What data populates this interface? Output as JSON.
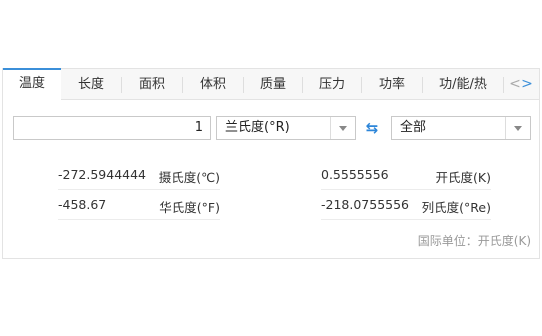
{
  "tabs": [
    {
      "label": "温度",
      "active": true
    },
    {
      "label": "长度",
      "active": false
    },
    {
      "label": "面积",
      "active": false
    },
    {
      "label": "体积",
      "active": false
    },
    {
      "label": "质量",
      "active": false
    },
    {
      "label": "压力",
      "active": false
    },
    {
      "label": "功率",
      "active": false
    },
    {
      "label": "功/能/热",
      "active": false
    }
  ],
  "nav": {
    "prev": "<",
    "next": ">"
  },
  "converter": {
    "input_value": "1",
    "from_unit": "兰氏度(°R)",
    "to_unit": "全部",
    "swap_icon": "swap-arrows-icon"
  },
  "results": [
    {
      "value": "-272.5944444",
      "unit": "摄氏度(℃)"
    },
    {
      "value": "0.5555556",
      "unit": "开氏度(K)"
    },
    {
      "value": "-458.67",
      "unit": "华氏度(°F)"
    },
    {
      "value": "-218.0755556",
      "unit": "列氏度(°Re)"
    }
  ],
  "footnote": "国际单位：开氏度(K)",
  "colors": {
    "accent": "#3b8fd9",
    "border": "#c9c9c9"
  }
}
